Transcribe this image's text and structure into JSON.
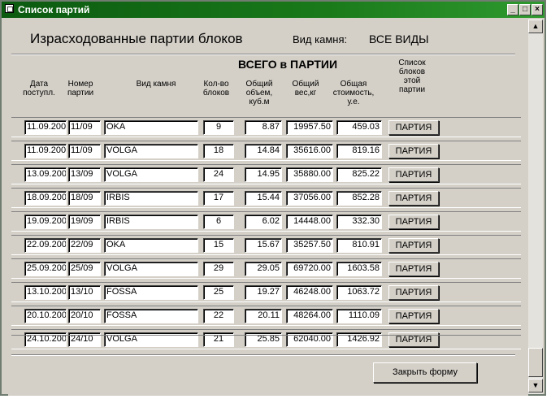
{
  "window": {
    "title": "Список партий",
    "minimize_glyph": "_",
    "restore_glyph": "□",
    "close_glyph": "×"
  },
  "heading": {
    "title": "Израсходованные партии блоков",
    "stone_label": "Вид камня:",
    "stone_value": "ВСЕ ВИДЫ"
  },
  "group_title": "ВСЕГО в ПАРТИИ",
  "columns": {
    "date": "Дата поступл.",
    "number": "Номер партии",
    "stone": "Вид камня",
    "count": "Кол-во блоков",
    "volume": "Общий объем, куб.м",
    "weight": "Общий вес,кг",
    "cost": "Общая стоимость, у.е.",
    "list": "Список блоков этой партии"
  },
  "rows": [
    {
      "date": "11.09.200",
      "number": "11/09",
      "stone": "OKA",
      "count": "9",
      "volume": "8.87",
      "weight": "19957.50",
      "cost": "459.03",
      "button": "ПАРТИЯ"
    },
    {
      "date": "11.09.200",
      "number": "11/09",
      "stone": "VOLGA",
      "count": "18",
      "volume": "14.84",
      "weight": "35616.00",
      "cost": "819.16",
      "button": "ПАРТИЯ"
    },
    {
      "date": "13.09.200",
      "number": "13/09",
      "stone": "VOLGA",
      "count": "24",
      "volume": "14.95",
      "weight": "35880.00",
      "cost": "825.22",
      "button": "ПАРТИЯ"
    },
    {
      "date": "18.09.200",
      "number": "18/09",
      "stone": "IRBIS",
      "count": "17",
      "volume": "15.44",
      "weight": "37056.00",
      "cost": "852.28",
      "button": "ПАРТИЯ"
    },
    {
      "date": "19.09.200",
      "number": "19/09",
      "stone": "IRBIS",
      "count": "6",
      "volume": "6.02",
      "weight": "14448.00",
      "cost": "332.30",
      "button": "ПАРТИЯ"
    },
    {
      "date": "22.09.200",
      "number": "22/09",
      "stone": "OKA",
      "count": "15",
      "volume": "15.67",
      "weight": "35257.50",
      "cost": "810.91",
      "button": "ПАРТИЯ"
    },
    {
      "date": "25.09.200",
      "number": "25/09",
      "stone": "VOLGA",
      "count": "29",
      "volume": "29.05",
      "weight": "69720.00",
      "cost": "1603.58",
      "button": "ПАРТИЯ"
    },
    {
      "date": "13.10.200",
      "number": "13/10",
      "stone": "FOSSA",
      "count": "25",
      "volume": "19.27",
      "weight": "46248.00",
      "cost": "1063.72",
      "button": "ПАРТИЯ"
    },
    {
      "date": "20.10.200",
      "number": "20/10",
      "stone": "FOSSA",
      "count": "22",
      "volume": "20.11",
      "weight": "48264.00",
      "cost": "1110.09",
      "button": "ПАРТИЯ"
    },
    {
      "date": "24.10.200",
      "number": "24/10",
      "stone": "VOLGA",
      "count": "21",
      "volume": "25.85",
      "weight": "62040.00",
      "cost": "1426.92",
      "button": "ПАРТИЯ"
    }
  ],
  "close_button": "Закрыть форму",
  "scrollbar": {
    "up_glyph": "▲",
    "down_glyph": "▼"
  }
}
